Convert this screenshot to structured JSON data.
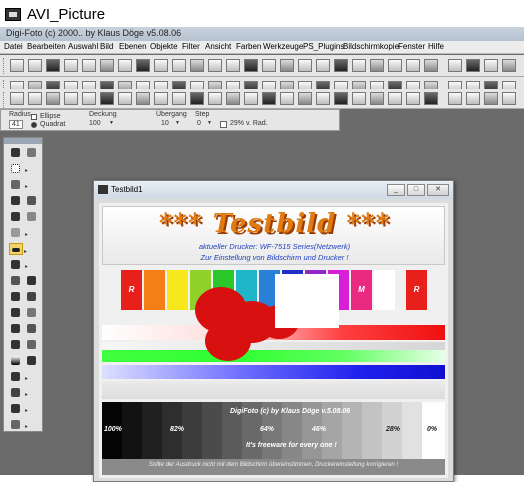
{
  "outer_window": {
    "title": "AVI_Picture"
  },
  "app": {
    "title": "Digi-Foto (c) 2000.. by Klaus Döge v5.08.06",
    "menu": [
      "Datei",
      "Bearbeiten",
      "Auswahl",
      "Bild",
      "Ebenen",
      "Objekte",
      "Filter",
      "Ansicht",
      "Farben",
      "Werkzeuge",
      "PS_Plugins",
      "Bildschirmkopie",
      "Fenster",
      "Hilfe"
    ]
  },
  "options_bar": {
    "radius_label": "Radius",
    "radius_value": "41",
    "ellipse_label": "Ellipse",
    "quadrat_label": "Quadrat",
    "deckung_label": "Deckung",
    "deckung_value": "100",
    "uebergang_label": "Übergang",
    "uebergang_value": "10",
    "step_label": "Step",
    "step_value": "0",
    "check_label": "29% v. Rad."
  },
  "document_window": {
    "title": "Testbild1",
    "buttons": [
      "minimize",
      "maximize",
      "close"
    ]
  },
  "testbild": {
    "headline": "*** Testbild ***",
    "line1": "aktueller Drucker: WF-7515 Series(Netzwerk)",
    "line2": "Zur Einstellung von Bildschirm und Drucker !",
    "bar_labels": {
      "r_left": "R",
      "m": "M",
      "r_right": "R"
    },
    "colors": [
      "#e8201c",
      "#f57f17",
      "#f6e81a",
      "#8fd22a",
      "#29c729",
      "#1fb6c9",
      "#2a7fd6",
      "#2130c9",
      "#9326c9",
      "#d61fd6",
      "#ea2a80",
      "#ffffff",
      "#e8201c"
    ],
    "credit": "DigiFoto (c) by Klaus Döge v.5.08.06",
    "freeware": "It's freeware for every one !",
    "percents": [
      "100%",
      "82%",
      "64%",
      "46%",
      "28%",
      "0%"
    ],
    "footer": "Sollte der Ausdruck nicht mit dem Bildschirm übereinstimmen, Druckereinstellung korrigieren !"
  }
}
